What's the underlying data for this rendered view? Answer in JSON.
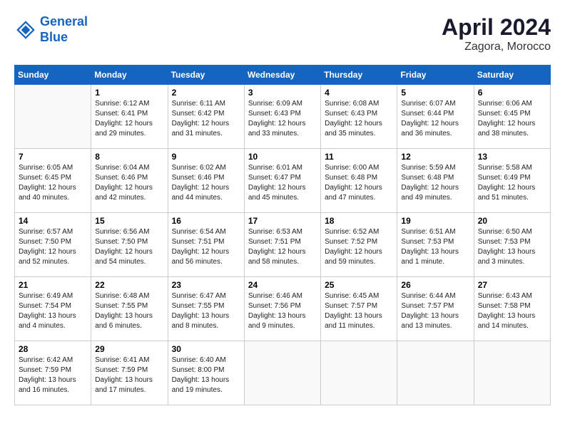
{
  "header": {
    "logo_line1": "General",
    "logo_line2": "Blue",
    "month": "April 2024",
    "location": "Zagora, Morocco"
  },
  "weekdays": [
    "Sunday",
    "Monday",
    "Tuesday",
    "Wednesday",
    "Thursday",
    "Friday",
    "Saturday"
  ],
  "weeks": [
    [
      {
        "day": "",
        "info": ""
      },
      {
        "day": "1",
        "info": "Sunrise: 6:12 AM\nSunset: 6:41 PM\nDaylight: 12 hours\nand 29 minutes."
      },
      {
        "day": "2",
        "info": "Sunrise: 6:11 AM\nSunset: 6:42 PM\nDaylight: 12 hours\nand 31 minutes."
      },
      {
        "day": "3",
        "info": "Sunrise: 6:09 AM\nSunset: 6:43 PM\nDaylight: 12 hours\nand 33 minutes."
      },
      {
        "day": "4",
        "info": "Sunrise: 6:08 AM\nSunset: 6:43 PM\nDaylight: 12 hours\nand 35 minutes."
      },
      {
        "day": "5",
        "info": "Sunrise: 6:07 AM\nSunset: 6:44 PM\nDaylight: 12 hours\nand 36 minutes."
      },
      {
        "day": "6",
        "info": "Sunrise: 6:06 AM\nSunset: 6:45 PM\nDaylight: 12 hours\nand 38 minutes."
      }
    ],
    [
      {
        "day": "7",
        "info": "Sunrise: 6:05 AM\nSunset: 6:45 PM\nDaylight: 12 hours\nand 40 minutes."
      },
      {
        "day": "8",
        "info": "Sunrise: 6:04 AM\nSunset: 6:46 PM\nDaylight: 12 hours\nand 42 minutes."
      },
      {
        "day": "9",
        "info": "Sunrise: 6:02 AM\nSunset: 6:46 PM\nDaylight: 12 hours\nand 44 minutes."
      },
      {
        "day": "10",
        "info": "Sunrise: 6:01 AM\nSunset: 6:47 PM\nDaylight: 12 hours\nand 45 minutes."
      },
      {
        "day": "11",
        "info": "Sunrise: 6:00 AM\nSunset: 6:48 PM\nDaylight: 12 hours\nand 47 minutes."
      },
      {
        "day": "12",
        "info": "Sunrise: 5:59 AM\nSunset: 6:48 PM\nDaylight: 12 hours\nand 49 minutes."
      },
      {
        "day": "13",
        "info": "Sunrise: 5:58 AM\nSunset: 6:49 PM\nDaylight: 12 hours\nand 51 minutes."
      }
    ],
    [
      {
        "day": "14",
        "info": "Sunrise: 6:57 AM\nSunset: 7:50 PM\nDaylight: 12 hours\nand 52 minutes."
      },
      {
        "day": "15",
        "info": "Sunrise: 6:56 AM\nSunset: 7:50 PM\nDaylight: 12 hours\nand 54 minutes."
      },
      {
        "day": "16",
        "info": "Sunrise: 6:54 AM\nSunset: 7:51 PM\nDaylight: 12 hours\nand 56 minutes."
      },
      {
        "day": "17",
        "info": "Sunrise: 6:53 AM\nSunset: 7:51 PM\nDaylight: 12 hours\nand 58 minutes."
      },
      {
        "day": "18",
        "info": "Sunrise: 6:52 AM\nSunset: 7:52 PM\nDaylight: 12 hours\nand 59 minutes."
      },
      {
        "day": "19",
        "info": "Sunrise: 6:51 AM\nSunset: 7:53 PM\nDaylight: 13 hours\nand 1 minute."
      },
      {
        "day": "20",
        "info": "Sunrise: 6:50 AM\nSunset: 7:53 PM\nDaylight: 13 hours\nand 3 minutes."
      }
    ],
    [
      {
        "day": "21",
        "info": "Sunrise: 6:49 AM\nSunset: 7:54 PM\nDaylight: 13 hours\nand 4 minutes."
      },
      {
        "day": "22",
        "info": "Sunrise: 6:48 AM\nSunset: 7:55 PM\nDaylight: 13 hours\nand 6 minutes."
      },
      {
        "day": "23",
        "info": "Sunrise: 6:47 AM\nSunset: 7:55 PM\nDaylight: 13 hours\nand 8 minutes."
      },
      {
        "day": "24",
        "info": "Sunrise: 6:46 AM\nSunset: 7:56 PM\nDaylight: 13 hours\nand 9 minutes."
      },
      {
        "day": "25",
        "info": "Sunrise: 6:45 AM\nSunset: 7:57 PM\nDaylight: 13 hours\nand 11 minutes."
      },
      {
        "day": "26",
        "info": "Sunrise: 6:44 AM\nSunset: 7:57 PM\nDaylight: 13 hours\nand 13 minutes."
      },
      {
        "day": "27",
        "info": "Sunrise: 6:43 AM\nSunset: 7:58 PM\nDaylight: 13 hours\nand 14 minutes."
      }
    ],
    [
      {
        "day": "28",
        "info": "Sunrise: 6:42 AM\nSunset: 7:59 PM\nDaylight: 13 hours\nand 16 minutes."
      },
      {
        "day": "29",
        "info": "Sunrise: 6:41 AM\nSunset: 7:59 PM\nDaylight: 13 hours\nand 17 minutes."
      },
      {
        "day": "30",
        "info": "Sunrise: 6:40 AM\nSunset: 8:00 PM\nDaylight: 13 hours\nand 19 minutes."
      },
      {
        "day": "",
        "info": ""
      },
      {
        "day": "",
        "info": ""
      },
      {
        "day": "",
        "info": ""
      },
      {
        "day": "",
        "info": ""
      }
    ]
  ]
}
